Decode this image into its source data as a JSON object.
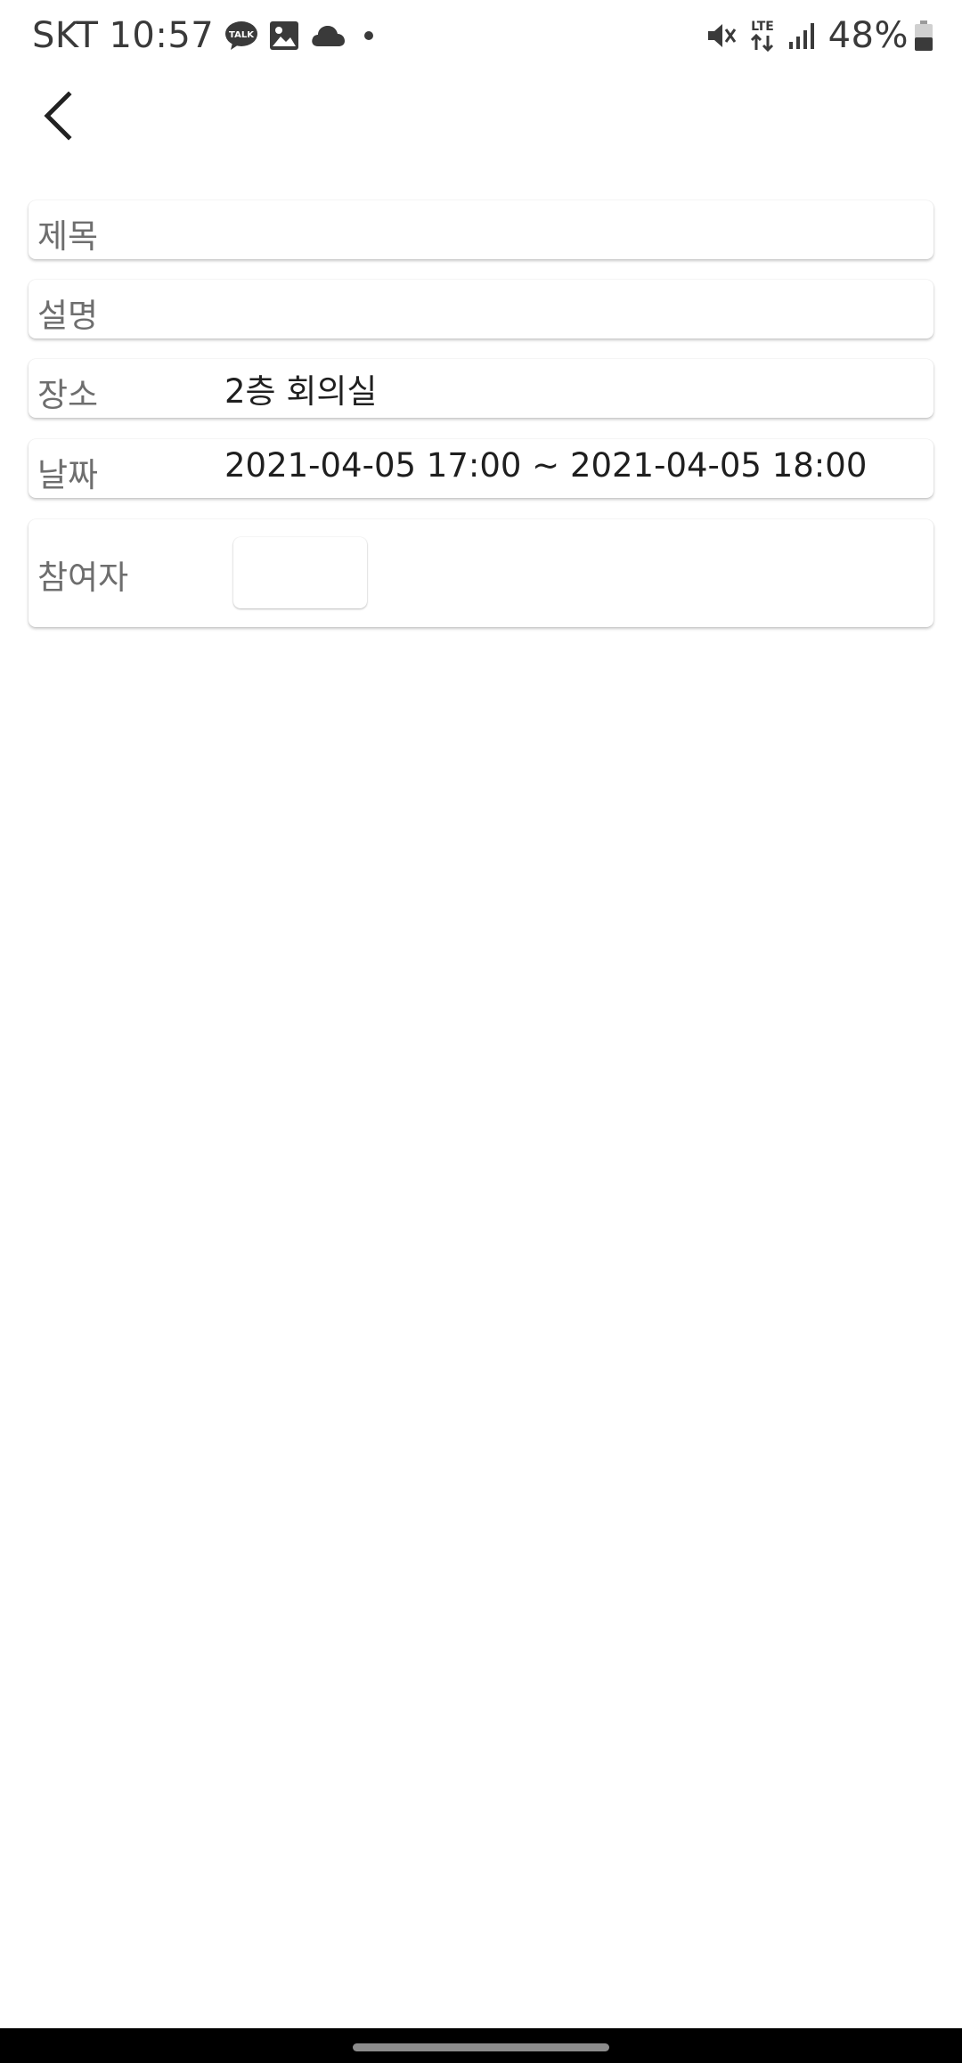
{
  "status_bar": {
    "carrier": "SKT",
    "time": "10:57",
    "network": "LTE",
    "battery": "48%",
    "notification_icons": [
      "kakaotalk-icon",
      "image-icon",
      "cloud-icon",
      "dot-icon"
    ],
    "system_icons": [
      "mute-vibrate-icon",
      "lte-icon",
      "signal-icon",
      "battery-icon"
    ]
  },
  "header": {
    "back_icon": "chevron-left-icon"
  },
  "form": {
    "title": {
      "label": "제목",
      "value": ""
    },
    "description": {
      "label": "설명",
      "value": ""
    },
    "location": {
      "label": "장소",
      "value": "2층 회의실"
    },
    "date": {
      "label": "날짜",
      "value": "2021-04-05 17:00 ~ 2021-04-05 18:00"
    },
    "participants": {
      "label": "참여자"
    }
  }
}
